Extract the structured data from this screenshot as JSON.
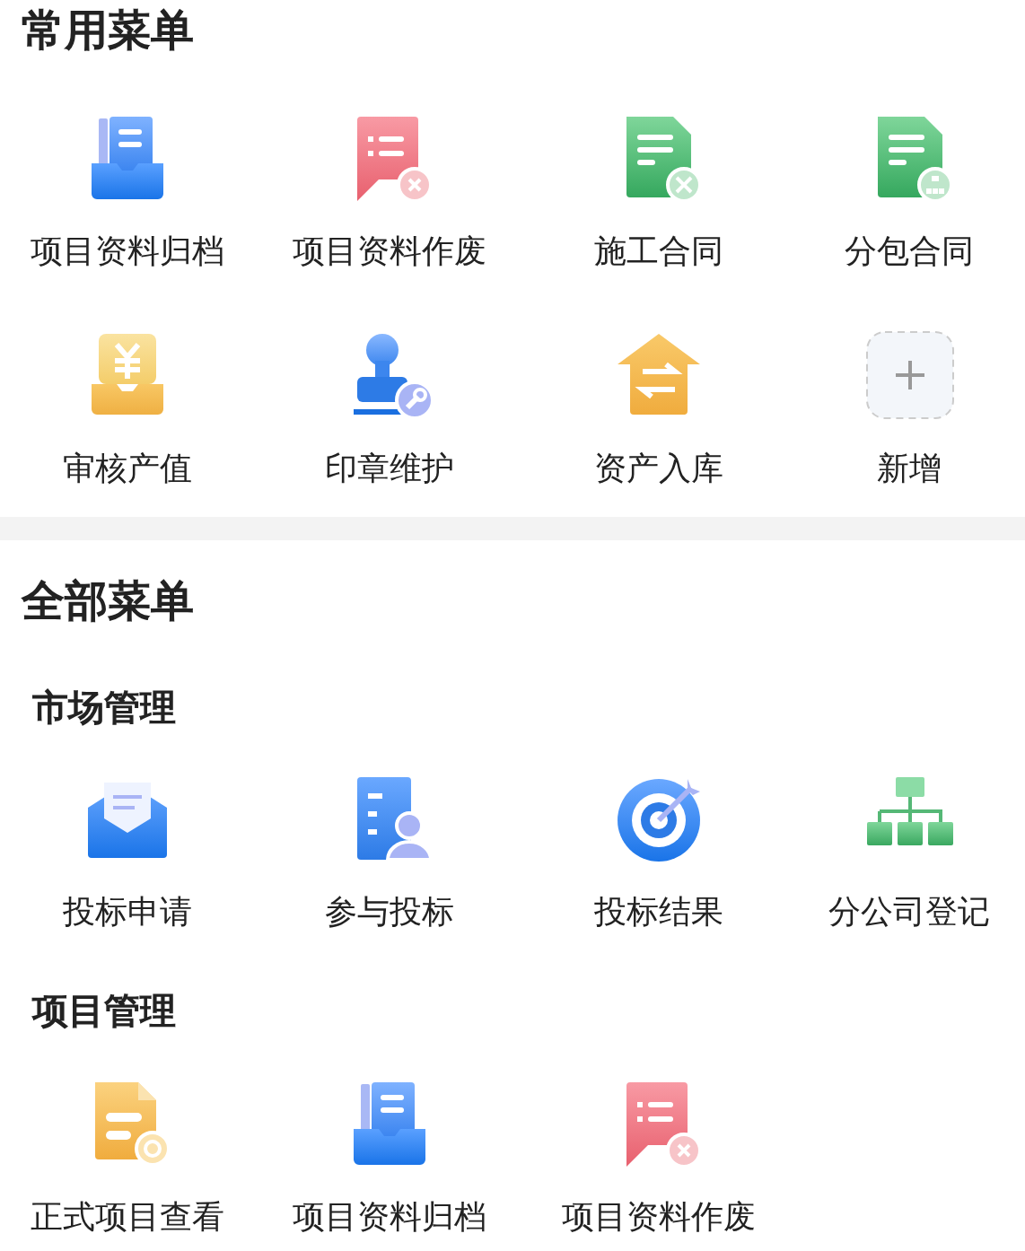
{
  "favorites": {
    "title": "常用菜单",
    "items": [
      {
        "label": "项目资料归档",
        "kind": "archive"
      },
      {
        "label": "项目资料作废",
        "kind": "void"
      },
      {
        "label": "施工合同",
        "kind": "contract"
      },
      {
        "label": "分包合同",
        "kind": "subcontract"
      },
      {
        "label": "审核产值",
        "kind": "yen"
      },
      {
        "label": "印章维护",
        "kind": "stamp"
      },
      {
        "label": "资产入库",
        "kind": "house"
      },
      {
        "label": "新增",
        "kind": "add"
      }
    ]
  },
  "all_menus": {
    "title": "全部菜单",
    "groups": [
      {
        "title": "市场管理",
        "items": [
          {
            "label": "投标申请",
            "kind": "envelope"
          },
          {
            "label": "参与投标",
            "kind": "person"
          },
          {
            "label": "投标结果",
            "kind": "target"
          },
          {
            "label": "分公司登记",
            "kind": "tree"
          }
        ]
      },
      {
        "title": "项目管理",
        "items": [
          {
            "label": "正式项目查看",
            "kind": "gear"
          },
          {
            "label": "项目资料归档",
            "kind": "archive"
          },
          {
            "label": "项目资料作废",
            "kind": "void"
          }
        ]
      }
    ]
  }
}
